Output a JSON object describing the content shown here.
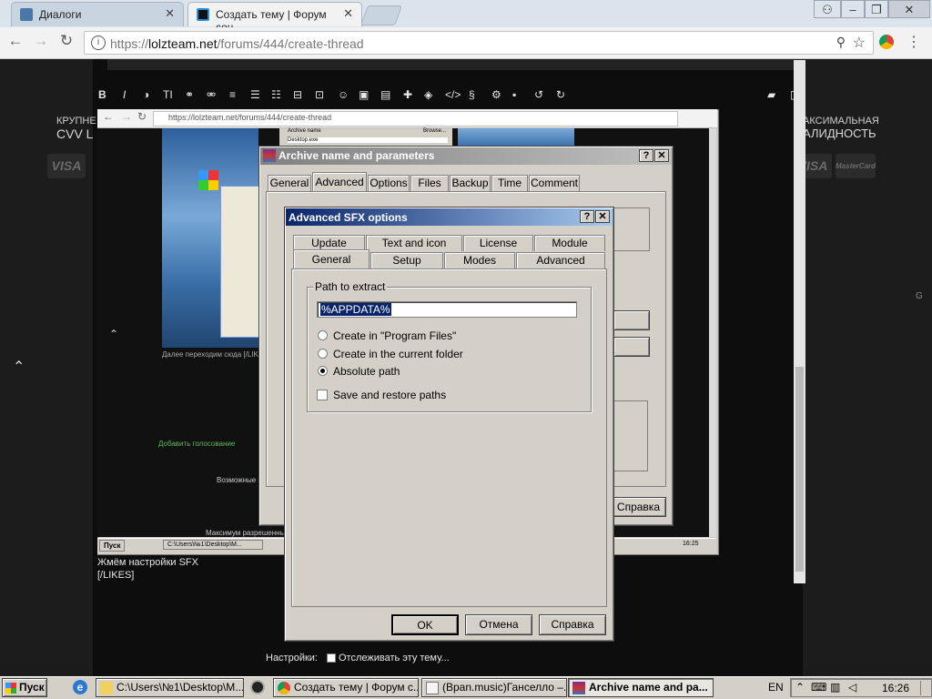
{
  "browser": {
    "tabs": [
      {
        "title": "Диалоги",
        "active": false
      },
      {
        "title": "Создать тему | Форум соц",
        "active": true
      }
    ],
    "url": {
      "scheme": "https://",
      "host": "lolzteam.net",
      "path": "/forums/444/create-thread"
    },
    "window_controls": {
      "user": "⚇",
      "minimize": "–",
      "restore": "❐",
      "close": "✕"
    }
  },
  "page": {
    "left_promo_top": "КРУПНЕ",
    "left_promo_bottom": "CVV L",
    "right_promo_top": "АКСИМАЛЬНАЯ",
    "right_promo_bottom": "АЛИДНОСТЬ",
    "visa_label": "VISA",
    "mastercard_label": "MasterCard",
    "caption_line1": "Жмём настройки SFX",
    "caption_line2": "[/LIKES]",
    "settings_label": "Настройки:",
    "settings_watch": "Отслеживать эту тему..."
  },
  "inner_screenshot": {
    "url": "https://lolzteam.net/forums/444/create-thread",
    "vote_link": "Добавить голосование",
    "max_text": "Максимум разрешенный",
    "important_text": "Возможные в",
    "under_text": "Далее переходим сюда [/LIKES]",
    "archive_name_field": "Desktop.exe",
    "archive_name_label": "Archive name",
    "browse_label": "Browse...",
    "start_label": "Пуск",
    "task_path": "C:\\Users\\№1\\Desktop\\M...",
    "clock": "16:25",
    "help_label": "Справка"
  },
  "archive_dialog": {
    "title": "Archive name and parameters",
    "help_btn": "?",
    "close_btn": "✕",
    "tabs": [
      "General",
      "Advanced",
      "Options",
      "Files",
      "Backup",
      "Time",
      "Comment"
    ],
    "active_tab": "Advanced",
    "help_button": "Справка"
  },
  "sfx_dialog": {
    "title": "Advanced SFX options",
    "help_btn": "?",
    "close_btn": "✕",
    "tabs_row1": [
      "Update",
      "Text and icon",
      "License",
      "Module"
    ],
    "tabs_row2": [
      "General",
      "Setup",
      "Modes",
      "Advanced"
    ],
    "active_tab": "General",
    "group_label": "Path to extract",
    "path_value": "%APPDATA%",
    "radio_program_files": "Create in \"Program Files\"",
    "radio_current_folder": "Create in the current folder",
    "radio_absolute": "Absolute path",
    "checkbox_save_paths": "Save and restore paths",
    "ok": "OK",
    "cancel": "Отмена",
    "help": "Справка"
  },
  "taskbar": {
    "start": "Пуск",
    "tasks": [
      {
        "title": "C:\\Users\\№1\\Desktop\\M...",
        "active": false
      },
      {
        "title": "Создать тему | Форум с...",
        "active": false
      },
      {
        "title": "(Вpan.music)Ганселло –...",
        "active": false
      },
      {
        "title": "Archive name and pa...",
        "active": true
      }
    ],
    "language": "EN",
    "clock": "16:26"
  },
  "colors": {
    "title_gradient_start": "#0a246a",
    "title_gradient_end": "#a6caf0",
    "win_face": "#d4d0c8",
    "selection": "#0a246a",
    "link_green": "#5cb85c"
  }
}
